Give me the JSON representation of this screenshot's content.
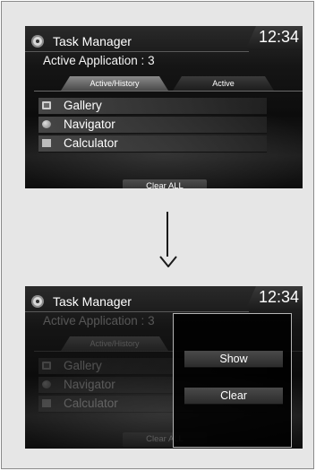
{
  "colors": {
    "screen_bg": "#151515",
    "text": "#ffffff",
    "frame_bg": "#e6e6e6"
  },
  "screens": [
    {
      "app_title": "Task Manager",
      "clock": "12:34",
      "subtitle": "Active Application : 3",
      "tabs": [
        {
          "label": "Active/History",
          "selected": true
        },
        {
          "label": "Active",
          "selected": false
        }
      ],
      "apps": [
        {
          "label": "Gallery",
          "icon": "gallery-icon"
        },
        {
          "label": "Navigator",
          "icon": "navigator-icon"
        },
        {
          "label": "Calculator",
          "icon": "calculator-icon"
        }
      ],
      "clear_all_label": "Clear ALL"
    },
    {
      "app_title": "Task Manager",
      "clock": "12:34",
      "subtitle": "Active Application : 3",
      "tabs": [
        {
          "label": "Active/History",
          "selected": true
        }
      ],
      "apps": [
        {
          "label": "Gallery",
          "icon": "gallery-icon"
        },
        {
          "label": "Navigator",
          "icon": "navigator-icon"
        },
        {
          "label": "Calculator",
          "icon": "calculator-icon"
        }
      ],
      "clear_all_label": "Clear ALL",
      "popup": {
        "show_label": "Show",
        "clear_label": "Clear"
      }
    }
  ],
  "transition_icon": "down-arrow-icon"
}
